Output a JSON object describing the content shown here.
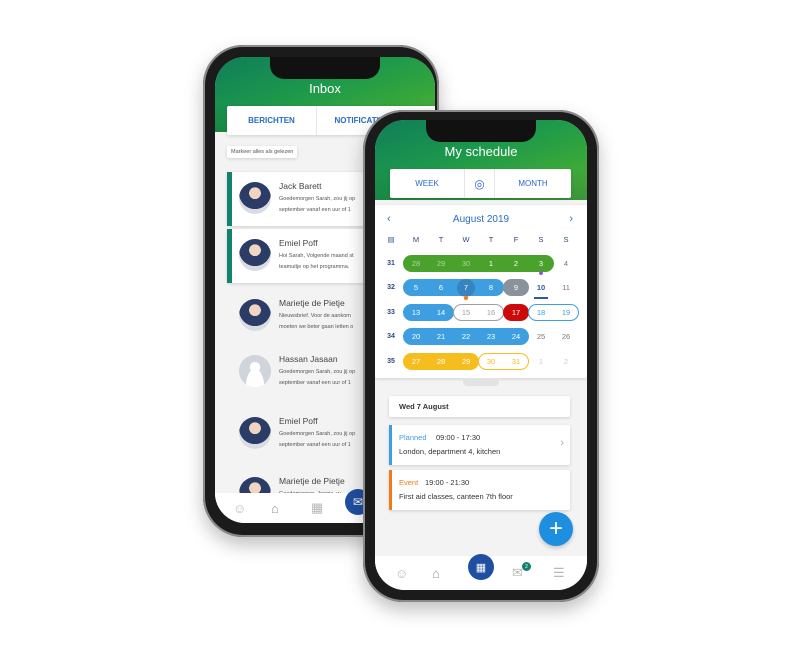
{
  "inbox": {
    "title": "Inbox",
    "tabs": [
      "BERICHTEN",
      "NOTIFICATIES"
    ],
    "mark_all": "Markeer alles als gelezen",
    "messages": [
      {
        "name": "Jack Barett",
        "line1": "Goedemorgen Sarah, zou jij op",
        "line2": "september vanaf een uur of 1",
        "unread": true,
        "avatar": "photo"
      },
      {
        "name": "Emiel Poff",
        "line1": "Hoi Sarah, Volgende maand st",
        "line2": "teamuitje op het programma.",
        "unread": true,
        "avatar": "photo"
      },
      {
        "name": "Marietje de Pietje",
        "line1": "Nieuwsbrief. Voor de aankom",
        "line2": "moeten we beter gaan letten o",
        "unread": false,
        "avatar": "photo"
      },
      {
        "name": "Hassan Jasaan",
        "line1": "Goedemorgen Sarah, zou jij op",
        "line2": "september vanaf een uur of 1",
        "unread": false,
        "avatar": "blank"
      },
      {
        "name": "Emiel Poff",
        "line1": "Goedemorgen Sarah, zou jij op",
        "line2": "september vanaf een uur of 1",
        "unread": false,
        "avatar": "photo"
      },
      {
        "name": "Marietje de Pietje",
        "line1": "Goedemorgen, Joopie, w",
        "line2": "september vanaf een u",
        "unread": false,
        "avatar": "photo"
      }
    ],
    "nav": [
      "user-icon",
      "home-icon",
      "calendar-icon",
      "mail-icon"
    ],
    "active_nav": "mail-icon"
  },
  "schedule": {
    "title": "My schedule",
    "tabs": {
      "week": "WEEK",
      "month": "MONTH"
    },
    "month_label": "August 2019",
    "weekdays": [
      "M",
      "T",
      "W",
      "T",
      "F",
      "S",
      "S"
    ],
    "weeks": [
      {
        "week": "31",
        "days": [
          "28",
          "29",
          "30",
          "1",
          "2",
          "3",
          "4"
        ]
      },
      {
        "week": "32",
        "days": [
          "5",
          "6",
          "7",
          "8",
          "9",
          "10",
          "11"
        ]
      },
      {
        "week": "33",
        "days": [
          "13",
          "14",
          "15",
          "16",
          "17",
          "18",
          "19"
        ]
      },
      {
        "week": "34",
        "days": [
          "20",
          "21",
          "22",
          "23",
          "24",
          "25",
          "26"
        ]
      },
      {
        "week": "35",
        "days": [
          "27",
          "28",
          "29",
          "30",
          "31",
          "1",
          "2"
        ]
      }
    ],
    "ranges": [
      {
        "week": 0,
        "from": 0,
        "to": 5,
        "style": "filled",
        "color": "#4aa12b"
      },
      {
        "week": 1,
        "from": 0,
        "to": 3,
        "style": "filled",
        "color": "#3d9ee0"
      },
      {
        "week": 1,
        "from": 4,
        "to": 4,
        "style": "filled",
        "color": "#8a939b"
      },
      {
        "week": 2,
        "from": 0,
        "to": 1,
        "style": "filled",
        "color": "#3d9ee0"
      },
      {
        "week": 2,
        "from": 2,
        "to": 3,
        "style": "outline",
        "color": "#9aa0a6"
      },
      {
        "week": 2,
        "from": 4,
        "to": 4,
        "style": "filled",
        "color": "#cc0a0a"
      },
      {
        "week": 2,
        "from": 5,
        "to": 6,
        "style": "outline",
        "color": "#3d9ee0"
      },
      {
        "week": 3,
        "from": 0,
        "to": 4,
        "style": "filled",
        "color": "#3d9ee0"
      },
      {
        "week": 4,
        "from": 0,
        "to": 2,
        "style": "filled",
        "color": "#f6bd1e"
      },
      {
        "week": 4,
        "from": 3,
        "to": 4,
        "style": "outline",
        "color": "#f6bd1e"
      }
    ],
    "today": {
      "week": 1,
      "day": 5
    },
    "selected": {
      "week": 1,
      "day": 2
    },
    "dots": [
      {
        "week": 0,
        "day": 5,
        "color": "#8a5be0"
      },
      {
        "week": 1,
        "day": 2,
        "color": "#f07a1a"
      }
    ],
    "selected_date": "Wed 7 August",
    "events": [
      {
        "type": "Planned",
        "time": "09:00 - 17:30",
        "desc": "London, department 4, kitchen",
        "color": "#3d9ee0"
      },
      {
        "type": "Event",
        "time": "19:00 - 21:30",
        "desc": "First aid classes, canteen 7th floor",
        "color": "#f07a1a"
      }
    ],
    "nav": [
      "user-icon",
      "home-icon",
      "calendar-icon",
      "mail-icon",
      "menu-icon"
    ],
    "active_nav": "calendar-icon",
    "mail_badge": "2"
  },
  "colors": {
    "accent": "#2a6bc6",
    "fab": "#1e8fe0",
    "nav_active": "#1f4fa0",
    "unread_bar": "#12826e"
  }
}
